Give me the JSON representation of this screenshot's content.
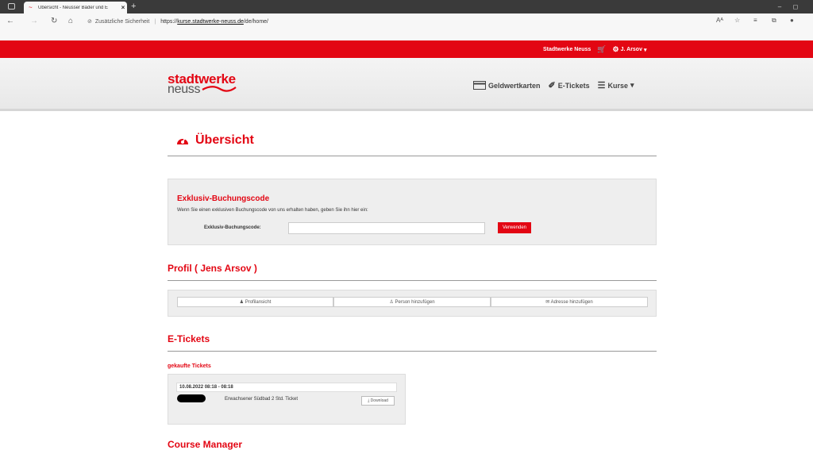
{
  "browser": {
    "tab_title": "Übersicht - Neusser Bäder und E",
    "security_label": "Zusätzliche Sicherheit",
    "url_prefix": "https://",
    "url_host": "kurse.stadtwerke-neuss.de",
    "url_path": "/de/home/"
  },
  "topbar": {
    "brand_link": "Stadtwerke Neuss",
    "user_menu": "J. Arsov"
  },
  "header": {
    "logo_line1": "stadtwerke",
    "logo_line2": "neuss",
    "nav": [
      {
        "label": "Geldwertkarten",
        "icon": "card-icon"
      },
      {
        "label": "E-Tickets",
        "icon": "ticket-icon"
      },
      {
        "label": "Kurse",
        "icon": "list-icon"
      }
    ]
  },
  "page": {
    "title": "Übersicht"
  },
  "booking": {
    "heading": "Exklusiv-Buchungscode",
    "hint": "Wenn Sie einen exklusiven Buchungscode von uns erhalten haben, geben Sie ihn hier ein:",
    "field_label": "Exklusiv-Buchungscode:",
    "field_value": "",
    "button": "Verwenden"
  },
  "profile": {
    "heading": "Profil ( Jens Arsov )",
    "buttons": [
      "Profilansicht",
      "Person hinzufügen",
      "Adresse hinzufügen"
    ]
  },
  "tickets": {
    "heading": "E-Tickets",
    "subheading": "gekaufte Tickets",
    "date": "10.08.2022 08:18 - 08:18",
    "name": "Erwachsener Südbad 2 Std. Ticket",
    "download": "Download"
  },
  "course": {
    "heading": "Course Manager"
  },
  "colors": {
    "brand_red": "#e30613"
  }
}
